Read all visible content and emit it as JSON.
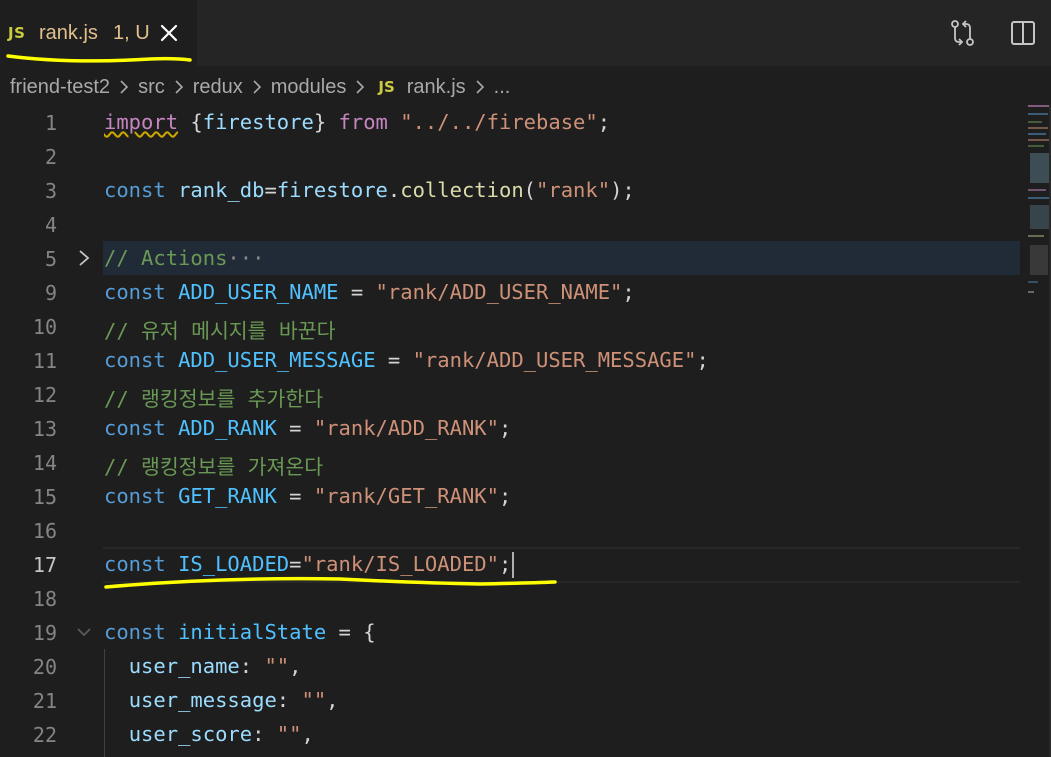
{
  "tab": {
    "lang_badge": "JS",
    "filename": "rank.js",
    "status": "1, U",
    "annotation_color": "#ffff00"
  },
  "actions": {
    "compare_icon": "git-compare-icon",
    "split_icon": "split-editor-icon"
  },
  "breadcrumb": {
    "items": [
      "friend-test2",
      "src",
      "redux",
      "modules"
    ],
    "file_badge": "JS",
    "file": "rank.js",
    "trailing": "..."
  },
  "editor": {
    "lines": [
      {
        "num": "1",
        "code": "import {firestore} from \"../../firebase\";"
      },
      {
        "num": "2",
        "code": ""
      },
      {
        "num": "3",
        "code": "const rank_db=firestore.collection(\"rank\");"
      },
      {
        "num": "4",
        "code": ""
      },
      {
        "num": "5",
        "code": "// Actions",
        "folded": true
      },
      {
        "num": "9",
        "code": "const ADD_USER_NAME = \"rank/ADD_USER_NAME\";"
      },
      {
        "num": "10",
        "code": "// 유저 메시지를 바꾼다"
      },
      {
        "num": "11",
        "code": "const ADD_USER_MESSAGE = \"rank/ADD_USER_MESSAGE\";"
      },
      {
        "num": "12",
        "code": "// 랭킹정보를 추가한다"
      },
      {
        "num": "13",
        "code": "const ADD_RANK = \"rank/ADD_RANK\";"
      },
      {
        "num": "14",
        "code": "// 랭킹정보를 가져온다"
      },
      {
        "num": "15",
        "code": "const GET_RANK = \"rank/GET_RANK\";"
      },
      {
        "num": "16",
        "code": ""
      },
      {
        "num": "17",
        "code": "const IS_LOADED=\"rank/IS_LOADED\";",
        "active": true
      },
      {
        "num": "18",
        "code": ""
      },
      {
        "num": "19",
        "code": "const initialState = {"
      },
      {
        "num": "20",
        "code": "  user_name: \"\","
      },
      {
        "num": "21",
        "code": "  user_message: \"\","
      },
      {
        "num": "22",
        "code": "  user_score: \"\","
      }
    ],
    "fold_ellipsis": "···"
  },
  "colors": {
    "background": "#1e1e1e",
    "keyword": "#569cd6",
    "string": "#ce9178",
    "comment": "#6a9955",
    "variable": "#9cdcfe"
  }
}
